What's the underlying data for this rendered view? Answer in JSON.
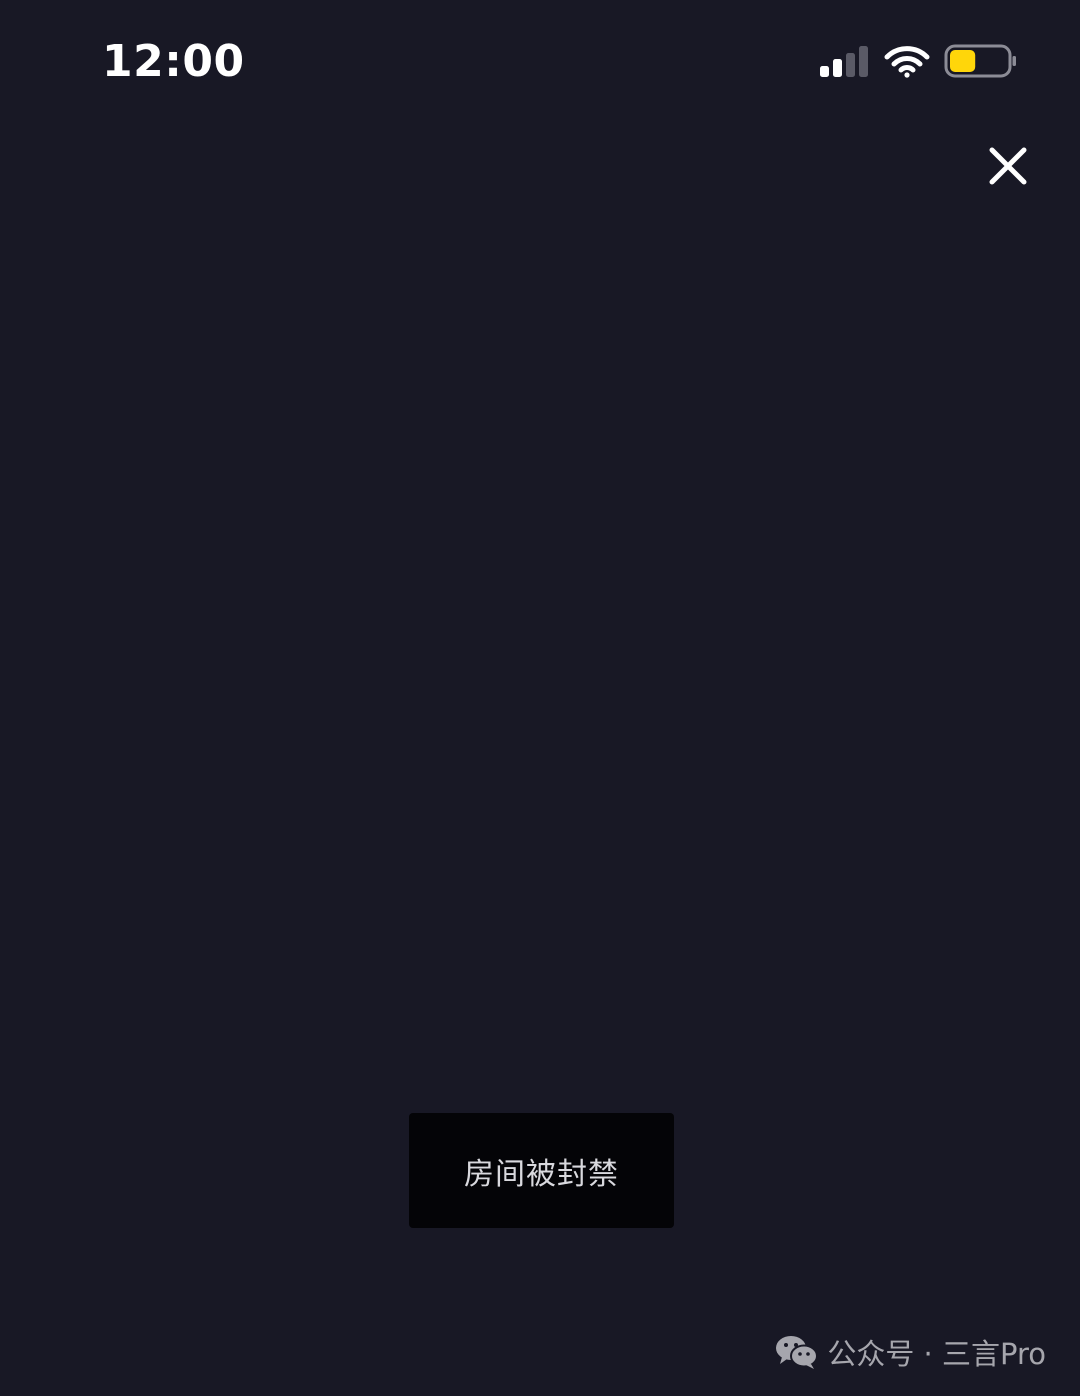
{
  "status_bar": {
    "time": "12:00",
    "signal_icon": "cellular-signal-icon",
    "wifi_icon": "wifi-icon",
    "battery_icon": "battery-icon",
    "battery_level": 0.45,
    "battery_color": "#FFD60A"
  },
  "header": {
    "close_icon": "close-icon"
  },
  "toast": {
    "message": "房间被封禁"
  },
  "watermark": {
    "icon": "wechat-logo-icon",
    "text": "公众号 · 三言Pro"
  },
  "colors": {
    "background": "#181825",
    "toast_background": "#040407"
  }
}
